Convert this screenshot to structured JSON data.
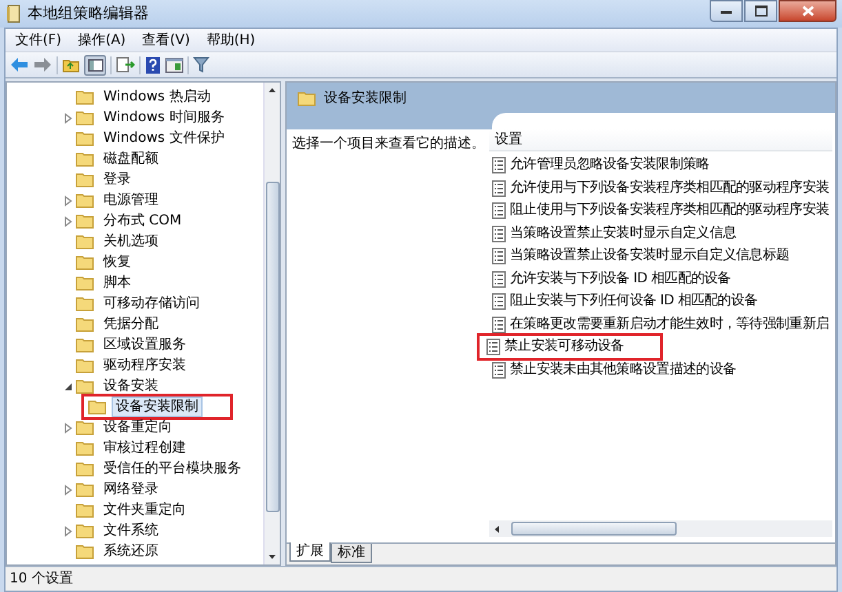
{
  "window": {
    "title": "本地组策略编辑器"
  },
  "menu": [
    "文件(F)",
    "操作(A)",
    "查看(V)",
    "帮助(H)"
  ],
  "tree": [
    {
      "label": "Windows 热启动",
      "selected": false,
      "annotated": false
    },
    {
      "label": "Windows 时间服务",
      "expanded": false,
      "selected": false,
      "annotated": false
    },
    {
      "label": "Windows 文件保护",
      "selected": false,
      "annotated": false
    },
    {
      "label": "磁盘配额",
      "selected": false,
      "annotated": false
    },
    {
      "label": "登录",
      "selected": false,
      "annotated": false
    },
    {
      "label": "电源管理",
      "expanded": false,
      "selected": false,
      "annotated": false
    },
    {
      "label": "分布式 COM",
      "expanded": false,
      "selected": false,
      "annotated": false
    },
    {
      "label": "关机选项",
      "selected": false,
      "annotated": false
    },
    {
      "label": "恢复",
      "selected": false,
      "annotated": false
    },
    {
      "label": "脚本",
      "selected": false,
      "annotated": false
    },
    {
      "label": "可移动存储访问",
      "selected": false,
      "annotated": false
    },
    {
      "label": "凭据分配",
      "selected": false,
      "annotated": false
    },
    {
      "label": "区域设置服务",
      "selected": false,
      "annotated": false
    },
    {
      "label": "驱动程序安装",
      "selected": false,
      "annotated": false
    },
    {
      "label": "设备安装",
      "expanded": true,
      "selected": false,
      "annotated": false,
      "children": [
        {
          "label": "设备安装限制",
          "selected": true,
          "annotated": true
        }
      ]
    },
    {
      "label": "设备重定向",
      "expanded": false,
      "selected": false,
      "annotated": false
    },
    {
      "label": "审核过程创建",
      "selected": false,
      "annotated": false
    },
    {
      "label": "受信任的平台模块服务",
      "selected": false,
      "annotated": false
    },
    {
      "label": "网络登录",
      "expanded": false,
      "selected": false,
      "annotated": false
    },
    {
      "label": "文件夹重定向",
      "selected": false,
      "annotated": false
    },
    {
      "label": "文件系统",
      "expanded": false,
      "selected": false,
      "annotated": false
    },
    {
      "label": "系统还原",
      "selected": false,
      "annotated": false
    }
  ],
  "header": {
    "title": "设备安装限制"
  },
  "description": "选择一个项目来查看它的描述。",
  "settings": {
    "column": "设置",
    "items": [
      {
        "label": "允许管理员忽略设备安装限制策略",
        "annotated": false
      },
      {
        "label": "允许使用与下列设备安装程序类相匹配的驱动程序安装",
        "annotated": false
      },
      {
        "label": "阻止使用与下列设备安装程序类相匹配的驱动程序安装",
        "annotated": false
      },
      {
        "label": "当策略设置禁止安装时显示自定义信息",
        "annotated": false
      },
      {
        "label": "当策略设置禁止设备安装时显示自定义信息标题",
        "annotated": false
      },
      {
        "label": "允许安装与下列设备 ID 相匹配的设备",
        "annotated": false
      },
      {
        "label": "阻止安装与下列任何设备 ID 相匹配的设备",
        "annotated": false
      },
      {
        "label": "在策略更改需要重新启动才能生效时，等待强制重新启",
        "annotated": false
      },
      {
        "label": "禁止安装可移动设备",
        "annotated": true
      },
      {
        "label": "禁止安装未由其他策略设置描述的设备",
        "annotated": false
      }
    ]
  },
  "tabs": [
    {
      "label": "扩展",
      "selected": true
    },
    {
      "label": "标准",
      "selected": false
    }
  ],
  "status_bar": "10 个设置"
}
